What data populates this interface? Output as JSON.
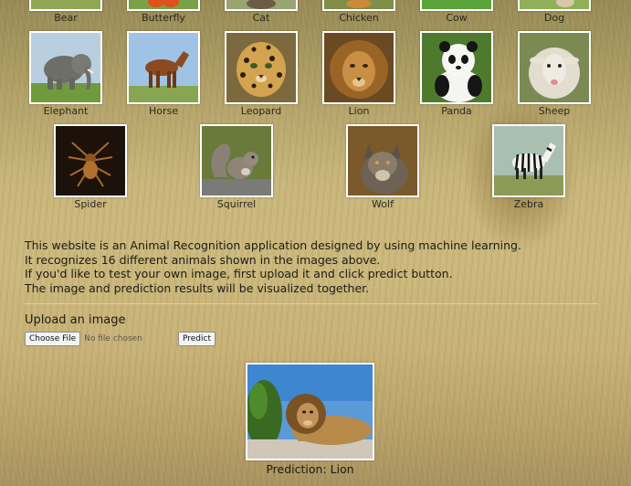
{
  "gallery": {
    "row0": [
      {
        "label": "Bear",
        "icon": "bear-photo"
      },
      {
        "label": "Butterfly",
        "icon": "butterfly-photo"
      },
      {
        "label": "Cat",
        "icon": "cat-photo"
      },
      {
        "label": "Chicken",
        "icon": "chicken-photo"
      },
      {
        "label": "Cow",
        "icon": "cow-photo"
      },
      {
        "label": "Dog",
        "icon": "dog-photo"
      }
    ],
    "row1": [
      {
        "label": "Elephant",
        "icon": "elephant-photo"
      },
      {
        "label": "Horse",
        "icon": "horse-photo"
      },
      {
        "label": "Leopard",
        "icon": "leopard-photo"
      },
      {
        "label": "Lion",
        "icon": "lion-photo"
      },
      {
        "label": "Panda",
        "icon": "panda-photo"
      },
      {
        "label": "Sheep",
        "icon": "sheep-photo"
      }
    ],
    "row2": [
      {
        "label": "Spider",
        "icon": "spider-photo"
      },
      {
        "label": "Squirrel",
        "icon": "squirrel-photo"
      },
      {
        "label": "Wolf",
        "icon": "wolf-photo"
      },
      {
        "label": "Zebra",
        "icon": "zebra-photo"
      }
    ]
  },
  "description": {
    "line1": "This website is an Animal Recognition application designed by using machine learning.",
    "line2": "It recognizes 16 different animals shown in the images above.",
    "line3": "If you'd like to test your own image, first upload it and click predict button.",
    "line4": "The image and prediction results will be visualized together."
  },
  "upload": {
    "title": "Upload an image",
    "choose_file_label": "Choose File",
    "file_status": "No file chosen",
    "predict_label": "Predict"
  },
  "result": {
    "image_icon": "lion-photo",
    "prediction_text": "Prediction: Lion"
  },
  "colors": {
    "background": "#c9b77c",
    "thumbnail_border": "#ffffff"
  }
}
